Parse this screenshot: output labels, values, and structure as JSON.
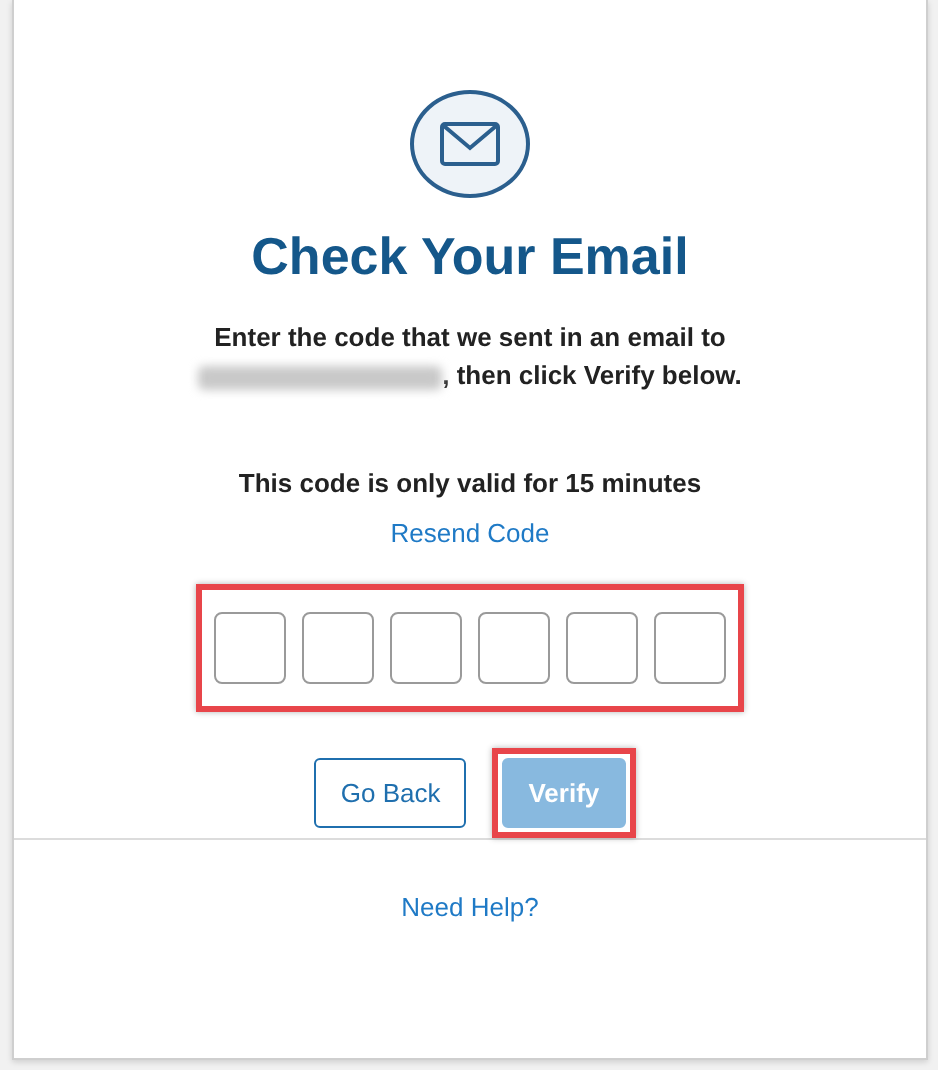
{
  "title": "Check Your Email",
  "instructions": {
    "before": "Enter the code that we sent in an email to",
    "email_redacted": true,
    "after": ", then click Verify below."
  },
  "validity": "This code is only valid for 15 minutes",
  "resend_link": "Resend Code",
  "code_fields": {
    "highlighted": true,
    "boxes": [
      {
        "focused": false
      },
      {
        "focused": false
      },
      {
        "focused": false
      },
      {
        "focused": false
      },
      {
        "focused": false
      },
      {
        "focused": false
      }
    ]
  },
  "buttons": [
    {
      "label": "Go Back",
      "kind": "outline",
      "disabled": false,
      "highlighted": false
    },
    {
      "label": "Verify",
      "kind": "primary",
      "disabled": true,
      "highlighted": true
    }
  ],
  "help_link": "Need Help?"
}
